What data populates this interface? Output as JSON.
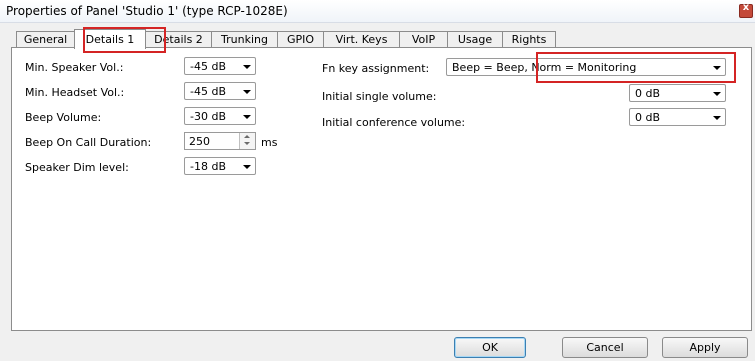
{
  "window": {
    "title": "Properties of Panel 'Studio 1' (type RCP-1028E)",
    "close_label": "x"
  },
  "tabs": [
    {
      "label": "General",
      "active": false
    },
    {
      "label": "Details 1",
      "active": true
    },
    {
      "label": "Details 2",
      "active": false
    },
    {
      "label": "Trunking",
      "active": false
    },
    {
      "label": "GPIO",
      "active": false
    },
    {
      "label": "Virt. Keys",
      "active": false
    },
    {
      "label": "VoIP",
      "active": false
    },
    {
      "label": "Usage",
      "active": false
    },
    {
      "label": "Rights",
      "active": false
    }
  ],
  "left_fields": {
    "speaker_vol": {
      "label": "Min. Speaker Vol.:",
      "value": "-45 dB"
    },
    "headset_vol": {
      "label": "Min. Headset Vol.:",
      "value": "-45 dB"
    },
    "beep_volume": {
      "label": "Beep Volume:",
      "value": "-30 dB"
    },
    "beep_duration": {
      "label": "Beep On Call Duration:",
      "value": "250",
      "unit": "ms"
    },
    "speaker_dim": {
      "label": "Speaker Dim level:",
      "value": "-18 dB"
    }
  },
  "right_fields": {
    "fn_key": {
      "label": "Fn key assignment:",
      "value": "Beep = Beep, Norm = Monitoring"
    },
    "initial_single": {
      "label": "Initial single volume:",
      "value": "0 dB"
    },
    "initial_conference": {
      "label": "Initial conference volume:",
      "value": "0 dB"
    }
  },
  "buttons": {
    "ok": "OK",
    "cancel": "Cancel",
    "apply": "Apply"
  },
  "colors": {
    "highlight": "#d42424",
    "default_button_border": "#3c7fb1"
  }
}
